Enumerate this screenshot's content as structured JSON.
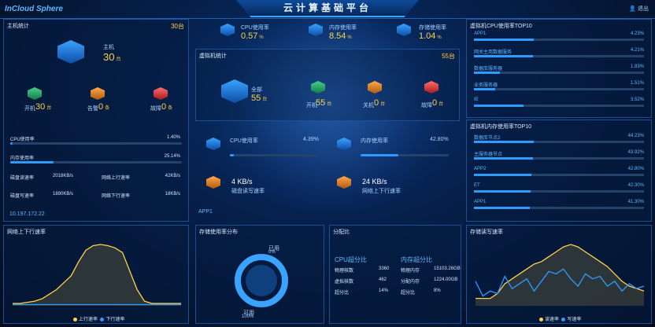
{
  "header": {
    "logo": "InCloud Sphere",
    "title": "云计算基础平台",
    "logout": "退出"
  },
  "colors": {
    "accent": "#2e9bff",
    "highlight": "#ffd24a",
    "green": "#48d08a",
    "orange": "#ffa84a",
    "red": "#ff6e6e"
  },
  "host_stats": {
    "title": "主机统计",
    "total": "30台",
    "host_label": "主机",
    "host_count": "30",
    "host_unit": "台",
    "running_label": "开机",
    "running_count": "30",
    "running_unit": "台",
    "alarm_label": "告警",
    "alarm_count": "0",
    "alarm_unit": "条",
    "fault_label": "故障",
    "fault_count": "0",
    "fault_unit": "条",
    "cpu_label": "CPU使用率",
    "cpu_value": "1.40%",
    "cpu_pct": 1.4,
    "mem_label": "内存使用率",
    "mem_value": "25.14%",
    "mem_pct": 25.14,
    "read_label": "磁盘读速率",
    "read_value": "2018KB/s",
    "net_up_label": "网络上行速率",
    "net_up_value": "42KB/s",
    "write_label": "磁盘写速率",
    "write_value": "1890KB/s",
    "net_down_label": "网络下行速率",
    "net_down_value": "18KB/s",
    "ip": "10.197.172.22"
  },
  "top_metrics": [
    {
      "label": "CPU使用率",
      "value": "0.57",
      "unit": "%"
    },
    {
      "label": "内存使用率",
      "value": "8.54",
      "unit": "%"
    },
    {
      "label": "存储使用率",
      "value": "1.04",
      "unit": "%"
    }
  ],
  "vm_stats": {
    "title": "虚拟机统计",
    "total": "55台",
    "all_label": "全部",
    "all_count": "55",
    "all_unit": "台",
    "running_label": "开机",
    "running_count": "55",
    "running_unit": "台",
    "alarm_label": "关机",
    "alarm_count": "0",
    "alarm_unit": "台",
    "fault_label": "故障",
    "fault_count": "0",
    "fault_unit": "台",
    "cpu_label": "CPU使用率",
    "cpu_value": "4.39%",
    "cpu_pct": 4.39,
    "mem_label": "内存使用率",
    "mem_value": "42.80%",
    "mem_pct": 42.8,
    "disk_rate": "4 KB/s",
    "disk_label": "磁盘读写速率",
    "net_rate": "24 KB/s",
    "net_label": "网络上下行速率",
    "app": "APP1"
  },
  "cpu_top": {
    "title": "虚拟机CPU使用率TOP10",
    "items": [
      {
        "name": "APP1",
        "value": "4.23%",
        "pct": 4.23
      },
      {
        "name": "网关主用数据服务",
        "value": "4.21%",
        "pct": 4.21
      },
      {
        "name": "数据库服务器",
        "value": "1.83%",
        "pct": 1.83
      },
      {
        "name": "业务服务器",
        "value": "1.51%",
        "pct": 1.51
      },
      {
        "name": "IE",
        "value": "3.52%",
        "pct": 3.52
      }
    ]
  },
  "mem_top": {
    "title": "虚拟机内存使用率TOP10",
    "items": [
      {
        "name": "数据库节点2",
        "value": "44.23%",
        "pct": 44.23
      },
      {
        "name": "主服务器节点",
        "value": "43.92%",
        "pct": 43.92
      },
      {
        "name": "APP2",
        "value": "42.80%",
        "pct": 42.8
      },
      {
        "name": "ET",
        "value": "42.30%",
        "pct": 42.3
      },
      {
        "name": "APP1",
        "value": "41.30%",
        "pct": 41.3
      }
    ]
  },
  "net_rate_panel": {
    "title": "网络上下行速率",
    "legend_up": "上行速率",
    "legend_down": "下行速率"
  },
  "storage_panel": {
    "title": "存储使用率分布",
    "used_label": "已用",
    "used_pct": "0%",
    "free_label": "可用",
    "free_pct": "100%"
  },
  "alloc_panel": {
    "title": "分配比",
    "cpu_title": "CPU超分比",
    "mem_title": "内存超分比",
    "cpu_rows": [
      {
        "k": "物理核数",
        "v": "3360"
      },
      {
        "k": "虚拟核数",
        "v": "462"
      },
      {
        "k": "超分比",
        "v": "14%"
      }
    ],
    "mem_rows": [
      {
        "k": "物理内存",
        "v": "15103.26GB"
      },
      {
        "k": "分配内存",
        "v": "1224.00GB"
      },
      {
        "k": "超分比",
        "v": "8%"
      }
    ]
  },
  "disk_panel": {
    "title": "存储读写速率",
    "legend_read": "读速率",
    "legend_write": "写速率"
  },
  "chart_data": [
    {
      "type": "area",
      "title": "网络上下行速率",
      "series": [
        {
          "name": "上行速率",
          "values": [
            2,
            2,
            3,
            4,
            6,
            10,
            14,
            20,
            26,
            38,
            48,
            52,
            53,
            52,
            50,
            46,
            30,
            14,
            4,
            2,
            2,
            2,
            2,
            2
          ]
        },
        {
          "name": "下行速率",
          "values": [
            1,
            1,
            1,
            1,
            1,
            1,
            1,
            1,
            1,
            1,
            1,
            1,
            1,
            1,
            1,
            1,
            1,
            1,
            1,
            1,
            1,
            1,
            1,
            1
          ]
        }
      ]
    },
    {
      "type": "area",
      "title": "存储读写速率",
      "series": [
        {
          "name": "读速率",
          "values": [
            6,
            6,
            6,
            10,
            18,
            22,
            26,
            30,
            34,
            36,
            40,
            44,
            48,
            50,
            48,
            44,
            40,
            36,
            32,
            26,
            20,
            16,
            14,
            12
          ]
        },
        {
          "name": "写速率",
          "values": [
            20,
            8,
            12,
            10,
            24,
            14,
            18,
            22,
            12,
            20,
            28,
            26,
            30,
            22,
            16,
            26,
            22,
            24,
            16,
            20,
            12,
            18,
            14,
            16
          ]
        }
      ]
    }
  ]
}
